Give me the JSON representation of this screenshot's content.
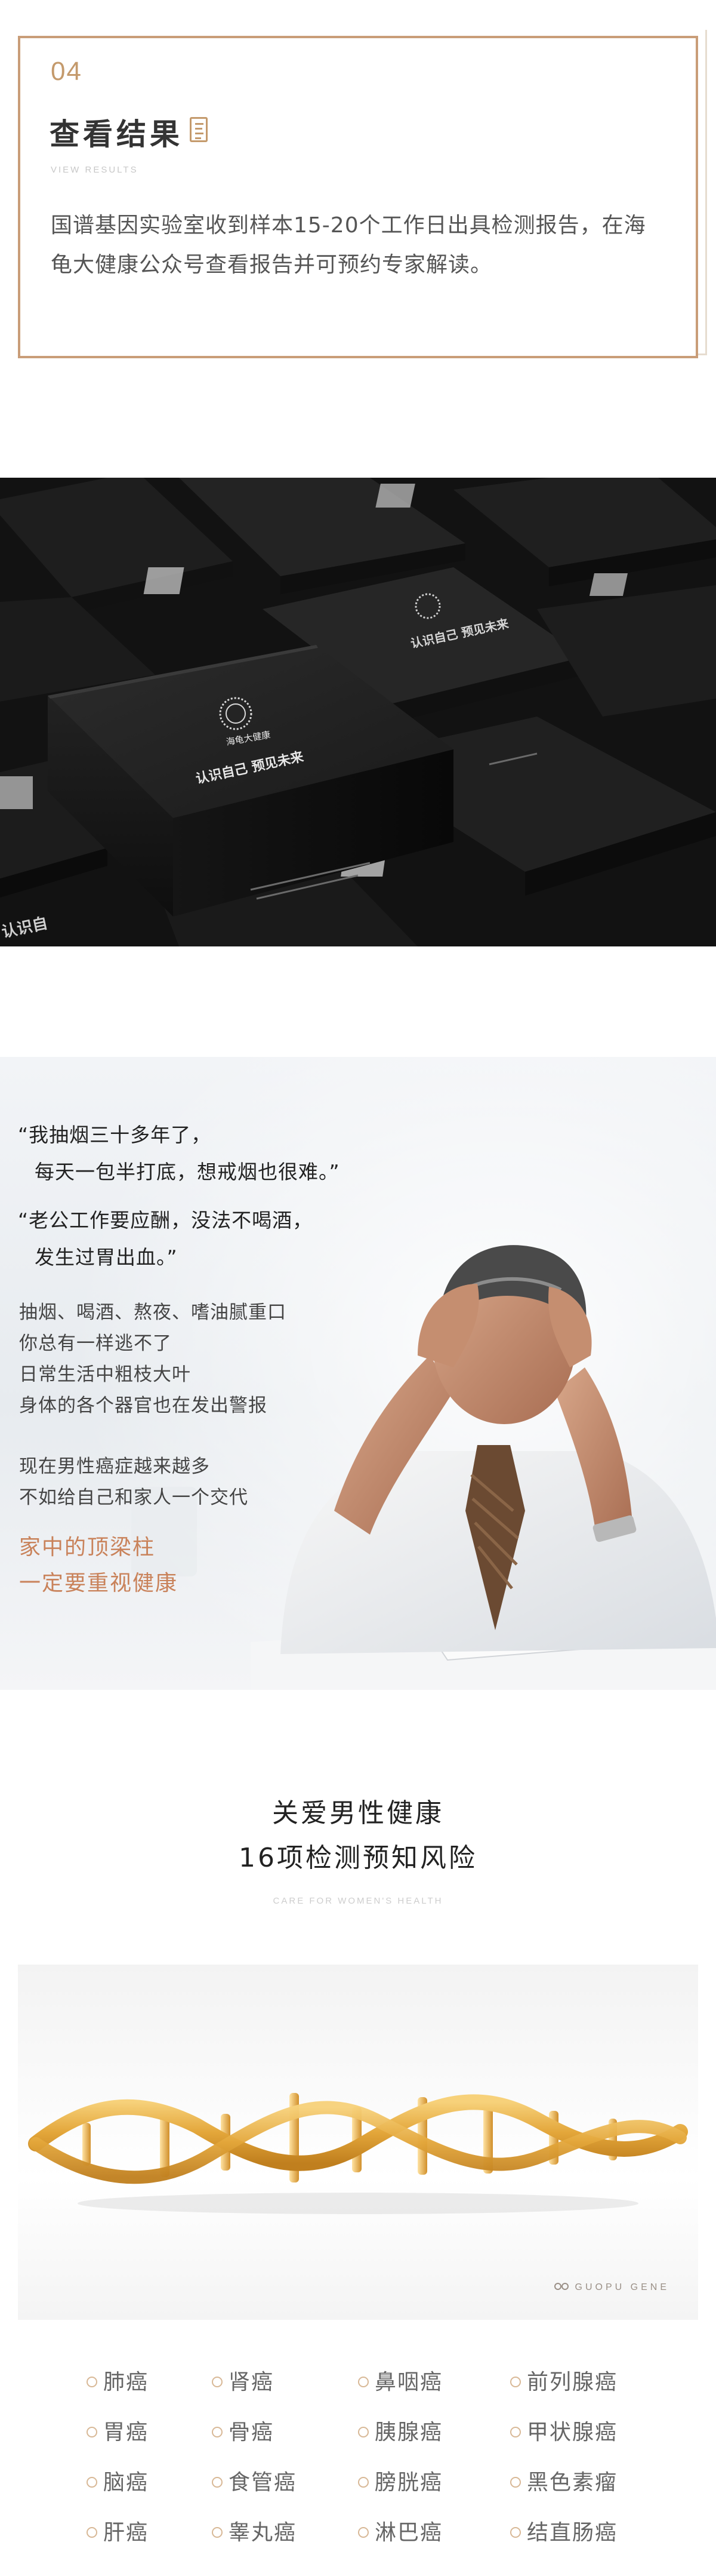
{
  "step": {
    "number": "04",
    "title": "查看结果",
    "subtitle": "VIEW RESULTS",
    "description": "国谱基因实验室收到样本15-20个工作日出具检测报告，在海龟大健康公众号查看报告并可预约专家解读。"
  },
  "product": {
    "brand_name": "海龟大健康",
    "slogan": "认识自己 预见未来",
    "side_text": "认识自"
  },
  "quote": {
    "line1": "“我抽烟三十多年了，",
    "line2": "每天一包半打底，想戒烟也很难。”",
    "line3": "“老公工作要应酬，没法不喝酒，",
    "line4": "发生过胃出血。”",
    "body": [
      "抽烟、喝酒、熬夜、嗜油腻重口",
      "你总有一样逃不了",
      "日常生活中粗枝大叶",
      "身体的各个器官也在发出警报"
    ],
    "body2": [
      "现在男性癌症越来越多",
      "不如给自己和家人一个交代"
    ],
    "accent": [
      "家中的顶梁柱",
      "一定要重视健康"
    ]
  },
  "care": {
    "title_line1": "关爱男性健康",
    "title_line2": "16项检测预知风险",
    "subtitle": "CARE FOR WOMEN'S HEALTH",
    "brand": "GUOPU GENE",
    "items": [
      "肺癌",
      "肾癌",
      "鼻咽癌",
      "前列腺癌",
      "胃癌",
      "骨癌",
      "胰腺癌",
      "甲状腺癌",
      "脑癌",
      "食管癌",
      "膀胱癌",
      "黑色素瘤",
      "肝癌",
      "睾丸癌",
      "淋巴癌",
      "结直肠癌"
    ]
  },
  "colors": {
    "gold": "#c49a6c",
    "card_border": "#c99d78",
    "accent_text": "#c9825a",
    "box_black": "#1b1b1b"
  }
}
